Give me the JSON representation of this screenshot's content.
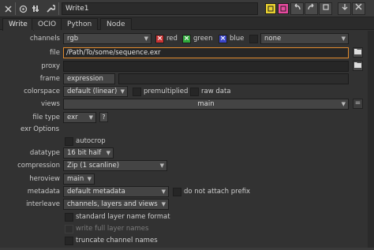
{
  "node": {
    "name": "Write1",
    "title_icons": {
      "close_icon": "close-x",
      "disable_icon": "circle",
      "settings_icon": "gear-dots",
      "wrench_icon": "wrench"
    },
    "colors": {
      "yellow_button": "#e8d030",
      "pink_button": "#e84aa0",
      "focus_outline": "#e08a2d"
    }
  },
  "tabs": [
    "Write",
    "OCIO",
    "Python",
    "Node"
  ],
  "active_tab": "Write",
  "knobs": {
    "channels": {
      "label": "channels",
      "value": "rgb",
      "red": "red",
      "green": "green",
      "blue": "blue",
      "extra": "none"
    },
    "file": {
      "label": "file",
      "value": "/Path/To/some/sequence.exr"
    },
    "proxy": {
      "label": "proxy",
      "value": ""
    },
    "frame": {
      "label": "frame",
      "value": "expression"
    },
    "colorspace": {
      "label": "colorspace",
      "value": "default (linear)",
      "premultiplied": "premultiplied",
      "raw_data": "raw data"
    },
    "views": {
      "label": "views",
      "value": "main"
    },
    "file_type": {
      "label": "file type",
      "value": "exr",
      "help": "?"
    },
    "exr_options": "exr Options",
    "autocrop": "autocrop",
    "datatype": {
      "label": "datatype",
      "value": "16 bit half"
    },
    "compression": {
      "label": "compression",
      "value": "Zip (1 scanline)"
    },
    "heroview": {
      "label": "heroview",
      "value": "main"
    },
    "metadata": {
      "label": "metadata",
      "value": "default metadata",
      "no_prefix": "do not attach prefix"
    },
    "interleave": {
      "label": "interleave",
      "value": "channels, layers and views"
    },
    "standard_layer": "standard layer name format",
    "write_full_layer": "write full layer names",
    "truncate": "truncate channel names"
  }
}
